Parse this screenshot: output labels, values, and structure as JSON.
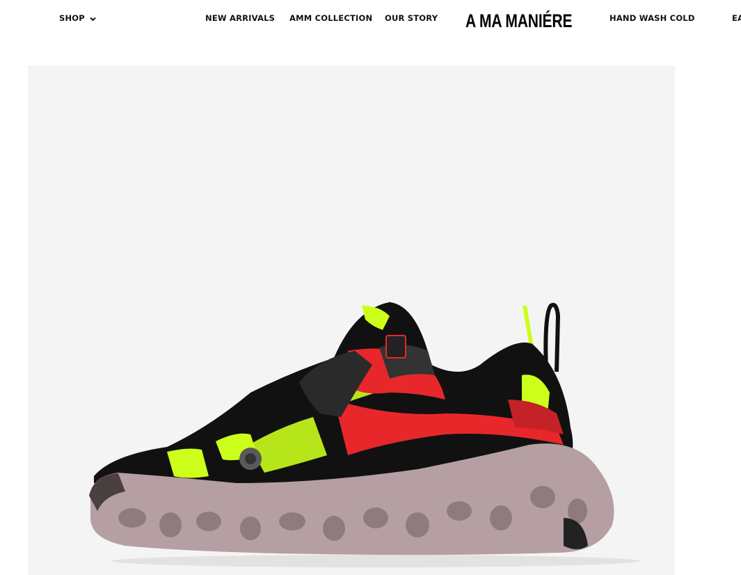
{
  "header": {
    "nav": {
      "shop": "SHOP",
      "new_arrivals": "NEW ARRIVALS",
      "amm_collection": "AMM COLLECTION",
      "our_story": "OUR STORY",
      "hand_wash_cold": "HAND WASH COLD",
      "truncated_item": "EA"
    },
    "logo": "A MA MANIÉRE"
  },
  "product": {
    "image": "sneaker-photo",
    "colors": {
      "background": "#f4f4f4",
      "upper": "#111111",
      "neon": "#ccff1a",
      "red": "#e8272a",
      "sole": "#b59fa2"
    }
  }
}
